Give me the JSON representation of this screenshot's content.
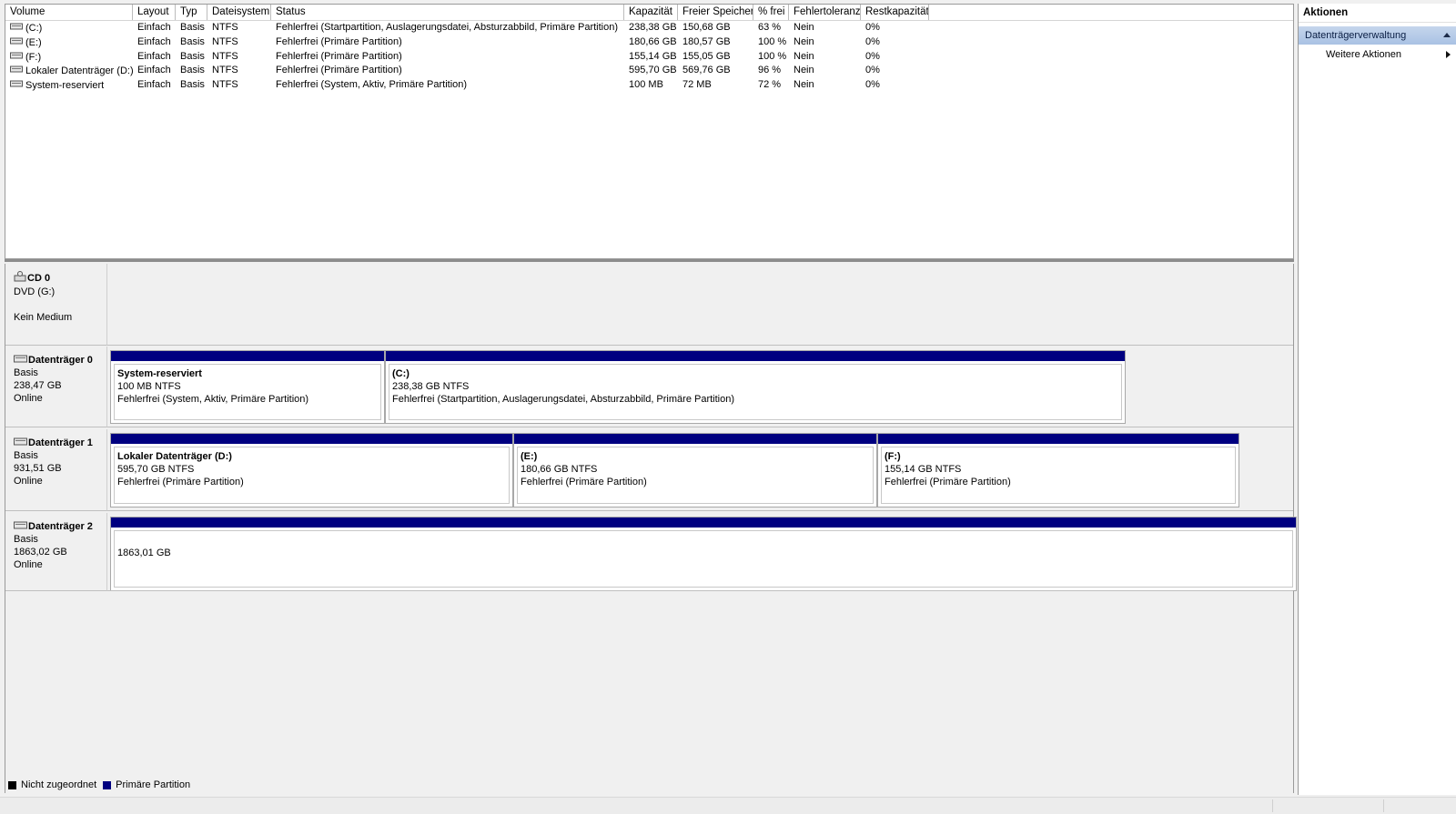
{
  "volume_table": {
    "columns": [
      "Volume",
      "Layout",
      "Typ",
      "Dateisystem",
      "Status",
      "Kapazität",
      "Freier Speicher",
      "% frei",
      "Fehlertoleranz",
      "Restkapazität"
    ],
    "rows": [
      {
        "volume": "(C:)",
        "layout": "Einfach",
        "typ": "Basis",
        "dateisystem": "NTFS",
        "status": "Fehlerfrei (Startpartition, Auslagerungsdatei, Absturzabbild, Primäre Partition)",
        "kapazitaet": "238,38 GB",
        "frei": "150,68 GB",
        "prozent_frei": "63 %",
        "fehlertoleranz": "Nein",
        "rest": "0%"
      },
      {
        "volume": "(E:)",
        "layout": "Einfach",
        "typ": "Basis",
        "dateisystem": "NTFS",
        "status": "Fehlerfrei (Primäre Partition)",
        "kapazitaet": "180,66 GB",
        "frei": "180,57 GB",
        "prozent_frei": "100 %",
        "fehlertoleranz": "Nein",
        "rest": "0%"
      },
      {
        "volume": "(F:)",
        "layout": "Einfach",
        "typ": "Basis",
        "dateisystem": "NTFS",
        "status": "Fehlerfrei (Primäre Partition)",
        "kapazitaet": "155,14 GB",
        "frei": "155,05 GB",
        "prozent_frei": "100 %",
        "fehlertoleranz": "Nein",
        "rest": "0%"
      },
      {
        "volume": "Lokaler Datenträger (D:)",
        "layout": "Einfach",
        "typ": "Basis",
        "dateisystem": "NTFS",
        "status": "Fehlerfrei (Primäre Partition)",
        "kapazitaet": "595,70 GB",
        "frei": "569,76 GB",
        "prozent_frei": "96 %",
        "fehlertoleranz": "Nein",
        "rest": "0%"
      },
      {
        "volume": "System-reserviert",
        "layout": "Einfach",
        "typ": "Basis",
        "dateisystem": "NTFS",
        "status": "Fehlerfrei (System, Aktiv, Primäre Partition)",
        "kapazitaet": "100 MB",
        "frei": "72 MB",
        "prozent_frei": "72 %",
        "fehlertoleranz": "Nein",
        "rest": "0%"
      }
    ]
  },
  "disks": [
    {
      "name": "CD 0",
      "lines": [
        "DVD (G:)",
        "",
        "Kein Medium"
      ],
      "icon": "cd-drive-icon"
    },
    {
      "name": "Datenträger 0",
      "lines": [
        "Basis",
        "238,47 GB",
        "Online"
      ],
      "icon": "hard-disk-icon",
      "partitions": [
        {
          "title": "System-reserviert",
          "size": "100 MB NTFS",
          "status": "Fehlerfrei (System, Aktiv, Primäre Partition)"
        },
        {
          "title": "(C:)",
          "size": "238,38 GB NTFS",
          "status": "Fehlerfrei (Startpartition, Auslagerungsdatei, Absturzabbild, Primäre Partition)"
        }
      ]
    },
    {
      "name": "Datenträger 1",
      "lines": [
        "Basis",
        "931,51 GB",
        "Online"
      ],
      "icon": "hard-disk-icon",
      "partitions": [
        {
          "title": "Lokaler Datenträger  (D:)",
          "size": "595,70 GB NTFS",
          "status": "Fehlerfrei (Primäre Partition)"
        },
        {
          "title": "(E:)",
          "size": "180,66 GB NTFS",
          "status": "Fehlerfrei (Primäre Partition)"
        },
        {
          "title": "(F:)",
          "size": "155,14 GB NTFS",
          "status": "Fehlerfrei (Primäre Partition)"
        }
      ]
    },
    {
      "name": "Datenträger 2",
      "lines": [
        "Basis",
        "1863,02 GB",
        "Online"
      ],
      "icon": "hard-disk-icon",
      "partitions": [
        {
          "title": "",
          "size": "",
          "status": "1863,01 GB"
        }
      ]
    }
  ],
  "legend": [
    {
      "label": "Nicht zugeordnet",
      "color": "#000000"
    },
    {
      "label": "Primäre Partition",
      "color": "#000080"
    }
  ],
  "actions": {
    "title": "Aktionen",
    "group": "Datenträgerverwaltung",
    "item": "Weitere Aktionen"
  }
}
